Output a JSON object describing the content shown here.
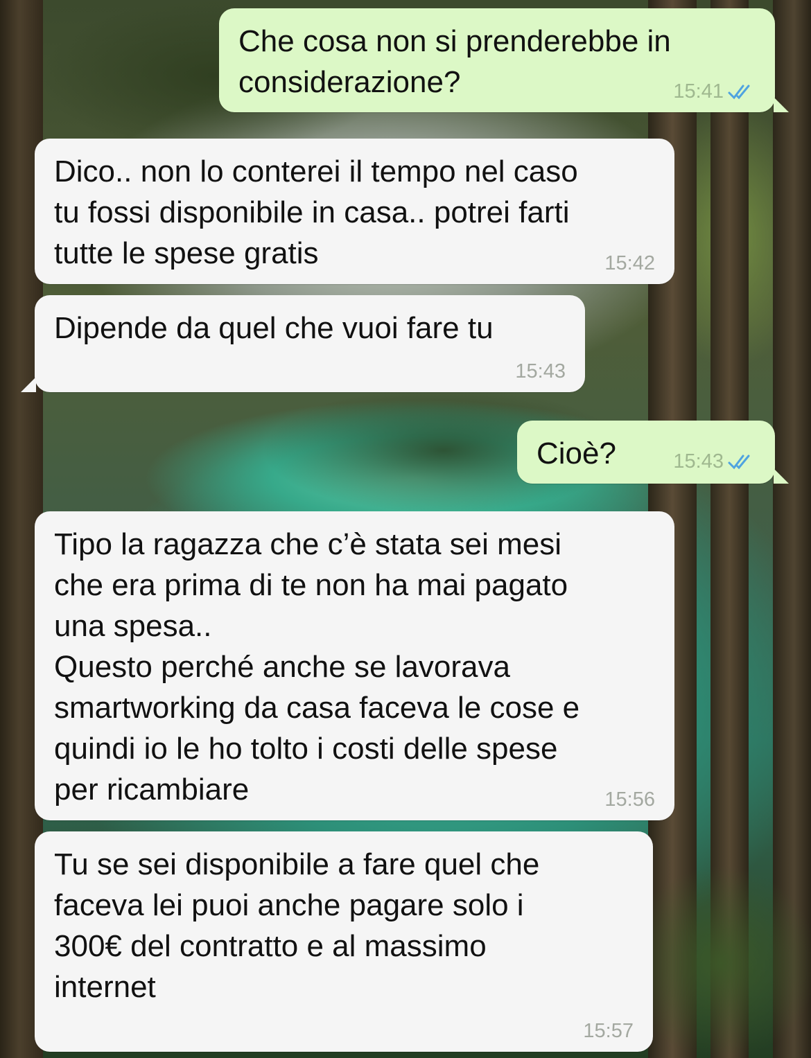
{
  "chat": {
    "messages": [
      {
        "direction": "outgoing",
        "text": "Che cosa non si prenderebbe in\nconsiderazione?",
        "time": "15:41",
        "status_icon": "double-check-icon"
      },
      {
        "direction": "incoming",
        "text": "Dico.. non lo conterei il tempo nel caso\ntu fossi disponibile in casa.. potrei farti\ntutte le spese gratis",
        "time": "15:42"
      },
      {
        "direction": "incoming",
        "text": "Dipende da quel che vuoi fare tu",
        "time": "15:43"
      },
      {
        "direction": "outgoing",
        "text": "Cioè?",
        "time": "15:43",
        "status_icon": "double-check-icon"
      },
      {
        "direction": "incoming",
        "text": "Tipo la ragazza che c’è stata sei mesi\nche era prima di te non ha mai pagato\nuna spesa..\nQuesto perché anche se lavorava\nsmartworking da casa faceva le cose e\nquindi io le ho tolto i costi delle spese\nper ricambiare",
        "time": "15:56"
      },
      {
        "direction": "incoming",
        "text": "Tu se sei disponibile a fare quel che\nfaceva lei puoi anche pagare solo i\n300€ del contratto e al massimo\ninternet",
        "time": "15:57"
      }
    ]
  },
  "colors": {
    "outgoing_bubble": "#dcf8c6",
    "incoming_bubble": "#f5f5f5",
    "read_ticks": "#4fa3e0",
    "timestamp": "#a3a8a0"
  }
}
